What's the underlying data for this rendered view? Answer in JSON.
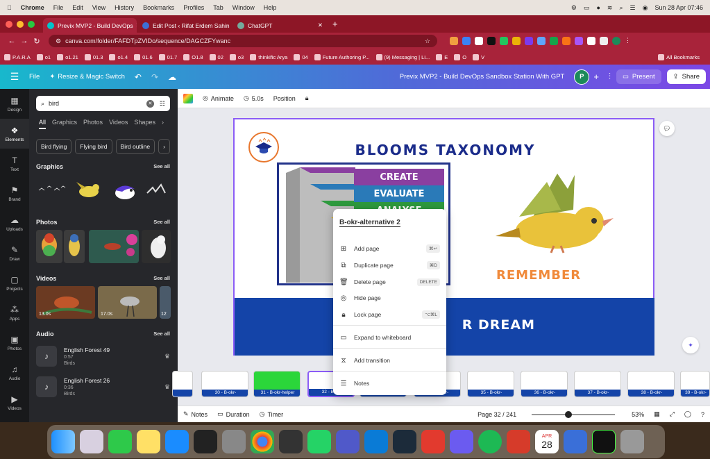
{
  "mac_menu": {
    "apple": "",
    "items": [
      "Chrome",
      "File",
      "Edit",
      "View",
      "History",
      "Bookmarks",
      "Profiles",
      "Tab",
      "Window",
      "Help"
    ],
    "datetime": "Sun 28 Apr 07:46"
  },
  "tabs": [
    {
      "label": "Previx MVP2 - Build DevOps"
    },
    {
      "label": "Edit Post ‹ Rifat Erdem Sahin"
    },
    {
      "label": "ChatGPT"
    }
  ],
  "address": {
    "url": "canva.com/folder/FAFDTpZVIDo/sequence/DAGCZFYwanc"
  },
  "bookmarks": [
    "P.A.R.A",
    "o1",
    "o1.21",
    "01.3",
    "o1.4",
    "01.6",
    "01.7",
    "O1.8",
    "02",
    "o3",
    "thinkific Arya",
    "04",
    "Future Authoring P...",
    "(9) Messaging | Li...",
    "E",
    "O",
    "",
    "",
    "V",
    "All Bookmarks"
  ],
  "canva_top": {
    "file": "File",
    "resize": "Resize & Magic Switch",
    "title": "Previx MVP2 - Build DevOps Sandbox Station  With GPT",
    "avatar": "P",
    "present": "Present",
    "share": "Share"
  },
  "rail": [
    "Design",
    "Elements",
    "Text",
    "Brand",
    "Uploads",
    "Draw",
    "Projects",
    "Apps",
    "Photos",
    "Audio",
    "Videos"
  ],
  "panel": {
    "search_value": "bird",
    "categories": [
      "All",
      "Graphics",
      "Photos",
      "Videos",
      "Shapes"
    ],
    "chips": [
      "Bird flying",
      "Flying bird",
      "Bird outline"
    ],
    "graphics": "Graphics",
    "photos": "Photos",
    "videos": "Videos",
    "audio": "Audio",
    "see_all": "See all",
    "video_durations": [
      "13.0s",
      "17.0s",
      "12"
    ],
    "audio_items": [
      {
        "title": "English Forest 49",
        "duration": "0:57",
        "tag": "Birds"
      },
      {
        "title": "English Forest 26",
        "duration": "0:36",
        "tag": "Birds"
      }
    ]
  },
  "toolbar": {
    "animate": "Animate",
    "duration": "5.0s",
    "position": "Position"
  },
  "slide": {
    "title": "BLOOMS TAXONOMY",
    "steps": [
      "CREATE",
      "EVALUATE",
      "ANALYSE"
    ],
    "remember": "REMEMBER",
    "banner": "R DREAM"
  },
  "context_menu": {
    "page_name": "B-okr-alternative 2",
    "items": [
      {
        "label": "Add page",
        "shortcut": "⌘↩"
      },
      {
        "label": "Duplicate page",
        "shortcut": "⌘D"
      },
      {
        "label": "Delete page",
        "shortcut": "DELETE"
      },
      {
        "label": "Hide page",
        "shortcut": ""
      },
      {
        "label": "Lock page",
        "shortcut": "⌥⌘L"
      },
      {
        "label": "Expand to whiteboard",
        "shortcut": ""
      },
      {
        "label": "Add transition",
        "shortcut": ""
      },
      {
        "label": "Notes",
        "shortcut": ""
      }
    ]
  },
  "pages": [
    {
      "label": "30 - B-okr-"
    },
    {
      "label": "31 - B-okr-helper"
    },
    {
      "label": "32 - B-okr-"
    },
    {
      "label": "33 - B-okr-"
    },
    {
      "label": "34 - B-okr-"
    },
    {
      "label": "35 - B-okr-"
    },
    {
      "label": "36 - B-okr-"
    },
    {
      "label": "37 - B-okr-"
    },
    {
      "label": "38 - B-okr-"
    },
    {
      "label": "39 - B-okr-"
    }
  ],
  "bottom": {
    "notes": "Notes",
    "duration": "Duration",
    "timer": "Timer",
    "page": "Page 32 / 241",
    "zoom": "53%"
  },
  "dock_calendar": {
    "month": "APR",
    "day": "28"
  },
  "colors": {
    "canva_purple": "#8b5cf6",
    "banner_blue": "#1444a8",
    "title_blue": "#1a2b8a",
    "orange": "#f08a3b"
  }
}
